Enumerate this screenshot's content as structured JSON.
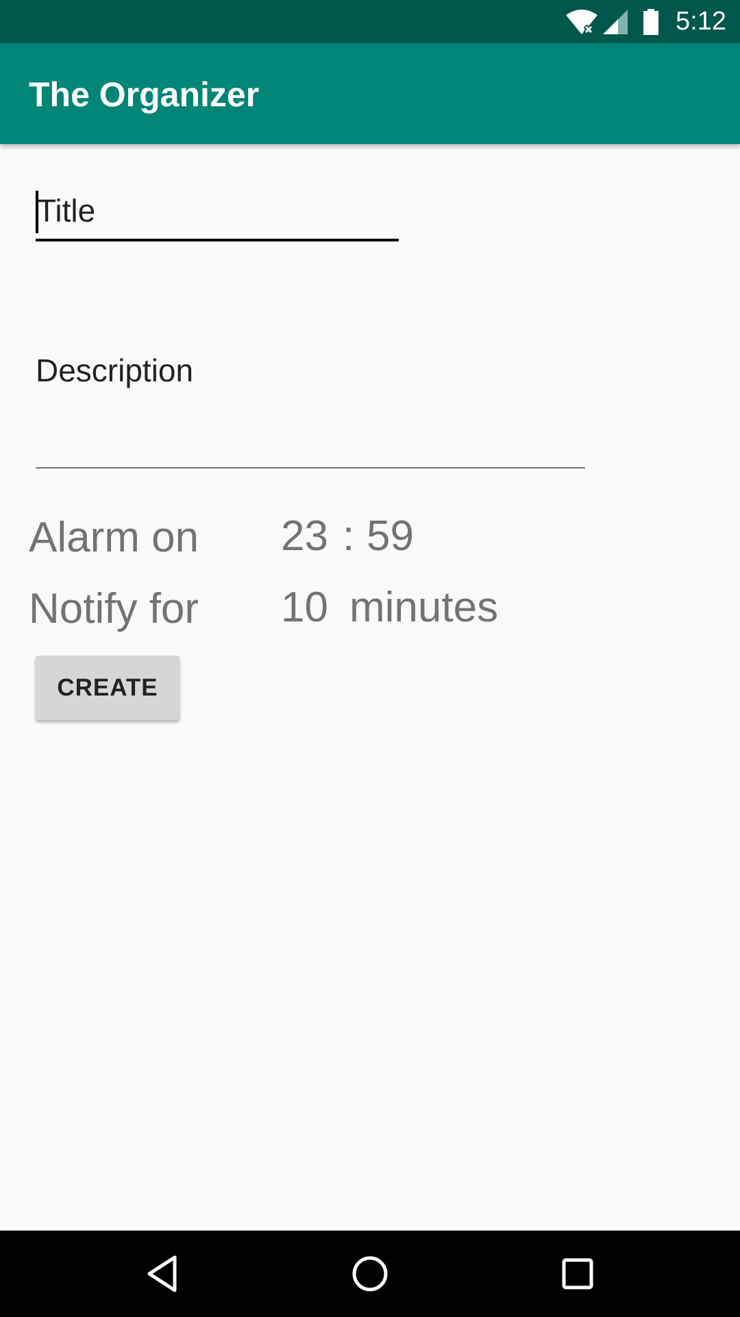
{
  "status_bar": {
    "time": "5:12",
    "icons": [
      "wifi-icon",
      "signal-icon",
      "battery-icon"
    ],
    "background_color": "#00574b"
  },
  "app_bar": {
    "title": "The Organizer",
    "background_color": "#008577"
  },
  "form": {
    "title_placeholder": "Title",
    "title_value": "",
    "description_placeholder": "Description",
    "description_value": ""
  },
  "alarm": {
    "label": "Alarm on",
    "hour": "23",
    "separator": ":",
    "minute": "59"
  },
  "notify": {
    "label": "Notify for",
    "value": "10",
    "unit": "minutes"
  },
  "actions": {
    "create_label": "CREATE"
  },
  "nav_bar": {
    "icons": [
      "back-icon",
      "home-icon",
      "recents-icon"
    ]
  }
}
